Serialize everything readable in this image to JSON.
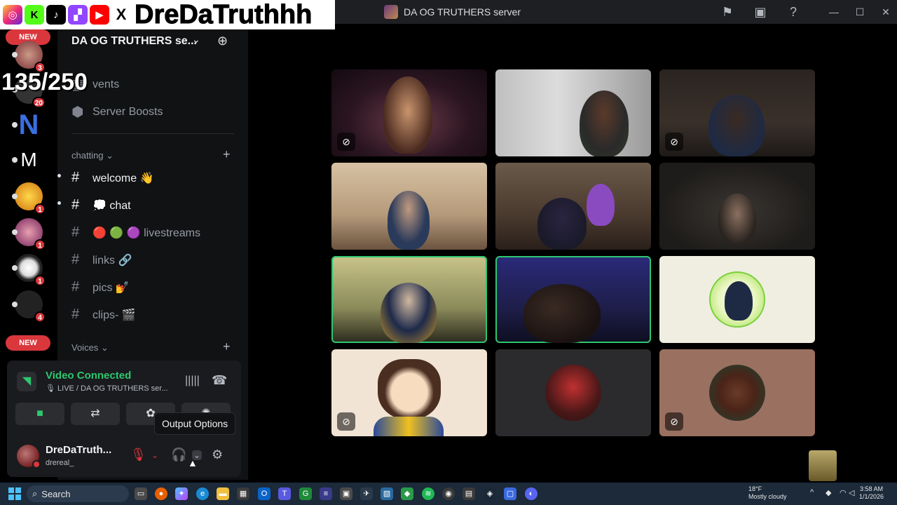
{
  "window": {
    "title": "DA OG TRUTHERS server",
    "icons": [
      "flag-icon",
      "inbox-icon",
      "help-icon"
    ],
    "controls": [
      "minimize",
      "maximize",
      "close"
    ]
  },
  "overlay": {
    "social_icons": [
      "instagram",
      "kick",
      "tiktok",
      "twitch",
      "youtube",
      "x"
    ],
    "channel_name": "DreDaTruthhh",
    "follower_count": "135/250"
  },
  "rail": {
    "new_top": "NEW",
    "new_bottom": "NEW",
    "badges": [
      "3",
      "20",
      "1",
      "1",
      "1",
      "4"
    ]
  },
  "sidebar": {
    "server_name": "DA OG TRUTHERS se...",
    "events": "Events",
    "events_visible": "vents",
    "server_boosts": "Server Boosts",
    "category_chatting": "chatting",
    "channels": [
      {
        "name": "welcome 👋",
        "bright": true
      },
      {
        "name": "💭 chat",
        "bright": true
      },
      {
        "name": "🔴 🟢 🟣 livestreams",
        "bright": false
      },
      {
        "name": "links 🔗",
        "bright": false
      },
      {
        "name": "pics 💅",
        "bright": false
      },
      {
        "name": "clips- 🎬",
        "bright": false
      }
    ],
    "category_voices": "Voices"
  },
  "voice": {
    "status": "Video Connected",
    "location": "🎙 LIVE / DA OG TRUTHERS ser...",
    "tooltip": "Output Options",
    "user_display": "DreDaTruth...",
    "user_handle": "drereal_"
  },
  "colors": {
    "accent_green": "#2dc770",
    "danger_red": "#da373c"
  },
  "taskbar": {
    "search_placeholder": "Search",
    "weather_temp": "18°F",
    "weather_desc": "Mostly cloudy",
    "time": "3:58 AM",
    "date": "1/1/2026"
  },
  "corner_logo": "CHAIN"
}
